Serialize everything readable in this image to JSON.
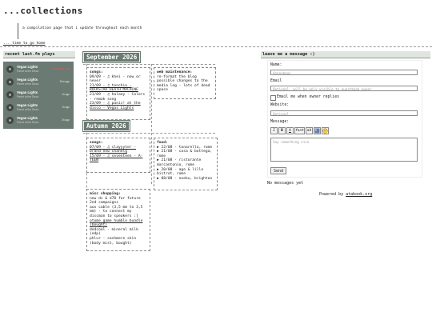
{
  "page": {
    "title": "...collections",
    "subtitle": "a compilation page that i update throughout each month",
    "back_link": "... time to go home"
  },
  "lastfm": {
    "header": "recent last.fm plays",
    "tracks": [
      {
        "name": "Vegan Lights",
        "album": "Parrot at the Disco",
        "when": "Scrobbling now"
      },
      {
        "name": "Vegan Lights",
        "album": "Parrot at the Disco",
        "when": "31m ago"
      },
      {
        "name": "Vegan Lights",
        "album": "Parrot at the Disco",
        "when": "1h ago"
      },
      {
        "name": "Vegan Lights",
        "album": "Parrot at the Disco",
        "when": "1h ago"
      },
      {
        "name": "Vegan Lights",
        "album": "Parrot at the Disco",
        "when": "2h ago"
      }
    ]
  },
  "september": {
    "title": "September 2026",
    "songs": {
      "header": "songs:",
      "items": [
        "09/09 - ♫ khei - now or never",
        "21/09 - ♫ tenchio - ROCKSTAR DEATH MACHINE",
        "21/09 - ♫ halaey - Colors - remak song",
        "23/09 - ♫ panic! at the disco - Vegas Lights"
      ]
    },
    "web": {
      "header": "web maintenance:",
      "items": [
        "re-format the blog",
        "possible changes to the media log - lots of dead space"
      ]
    }
  },
  "autumn": {
    "title": "Autumn 2026",
    "songs": {
      "header": "songs:",
      "items": [
        "07/09 - ♫ slayyyter - brand new chanelg",
        "15/09 - ♫ seventeen - A-TEEN"
      ]
    },
    "food": {
      "header": "food:",
      "items": [
        "▶ 22/08 - tonarello, rome",
        "▶ 21/08 - casa & bottega, rome",
        "▶ 21/08 - ristorante marcantonio, rome",
        "▶ 20/08 - ago & lillo bistrot, rome",
        "▶ 08/08 - neeku, brighton"
      ]
    },
    "shopping": {
      "header": "misc shopping:",
      "items": [
        "new ds & d70 for future 2nd campaigns",
        "aux cable (3,5 mm to 3,5 mm) - to connect my discman to speakers :]",
        "otome game humble bundle (bought)",
        "dedcool - mineral milk (edp)",
        "phlur - cashmere skin (body mist, bought)"
      ]
    }
  },
  "guestbook": {
    "header": "leave me a message :)",
    "name_label": "Name:",
    "name_placeholder": "Anonymous",
    "email_label": "Email",
    "email_placeholder": "Optional, will be only visible to guestbook owner",
    "notify_label": "Email me when owner replies",
    "website_label": "Website:",
    "website_placeholder": "Optional",
    "message_label": "Message:",
    "message_placeholder": "Say something nice",
    "send_label": "Send",
    "toolbar": [
      "I",
      "B",
      "A",
      "font",
      "aA",
      "img",
      "emoji"
    ],
    "no_messages": "No messages yet",
    "powered_prefix": "Powered by ",
    "powered_link": "atabook.org"
  },
  "colors": {
    "accent": "#6b7a72",
    "header_bg": "#dfe6df",
    "now_playing": "#e85b5b"
  }
}
